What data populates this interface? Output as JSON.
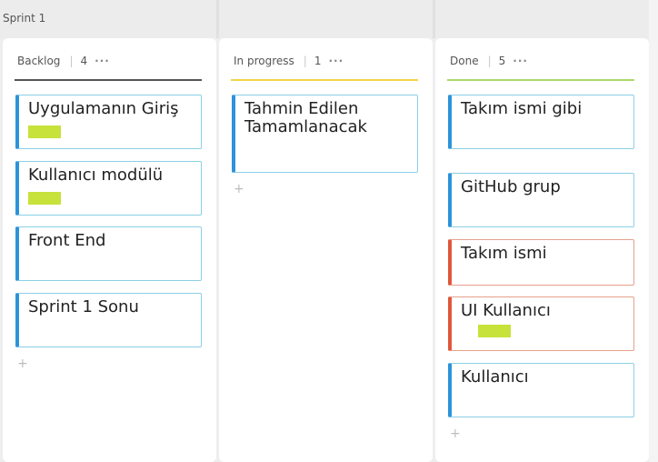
{
  "sprint": {
    "name": "Sprint 1"
  },
  "columns": [
    {
      "title": "Backlog",
      "count": "4",
      "more": "···",
      "accent": "#555555",
      "add": "+",
      "cards": [
        {
          "title": "Uygulamanın Giriş",
          "tag": true,
          "color": "blue"
        },
        {
          "title": "Kullanıcı modülü",
          "tag": true,
          "color": "blue"
        },
        {
          "title": "Front End",
          "tag": false,
          "color": "blue"
        },
        {
          "title": "Sprint 1 Sonu",
          "tag": false,
          "color": "blue"
        }
      ]
    },
    {
      "title": "In progress",
      "count": "1",
      "more": "···",
      "accent": "#f1d54a",
      "add": "+",
      "cards": [
        {
          "title": "Tahmin Edilen Tamamlanacak",
          "tag": false,
          "color": "blue"
        }
      ]
    },
    {
      "title": "Done",
      "count": "5",
      "more": "···",
      "accent": "#a9d96a",
      "add": "+",
      "cards": [
        {
          "title": "Takım ismi gibi",
          "tag": false,
          "color": "blue"
        },
        {
          "title": "GitHub grup",
          "tag": false,
          "color": "blue"
        },
        {
          "title": "Takım ismi",
          "tag": false,
          "color": "red"
        },
        {
          "title": "UI Kullanıcı",
          "tag": true,
          "color": "red"
        },
        {
          "title": "Kullanıcı",
          "tag": false,
          "color": "blue"
        }
      ]
    }
  ]
}
